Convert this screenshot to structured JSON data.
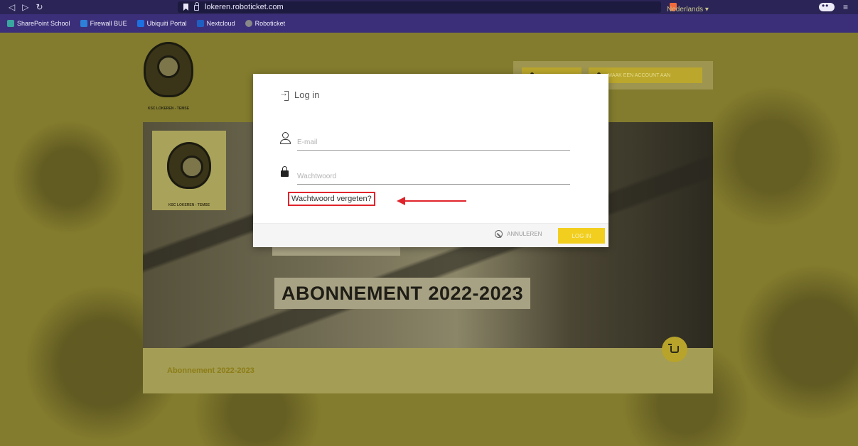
{
  "browser": {
    "url": "lokeren.roboticket.com",
    "bookmarks": [
      {
        "label": "SharePoint School",
        "color": "#3aa6a0"
      },
      {
        "label": "Firewall BUE",
        "color": "#2d7fd8"
      },
      {
        "label": "Ubiquiti Portal",
        "color": "#1e6fe0"
      },
      {
        "label": "Nextcloud",
        "color": "#1f5fc2"
      },
      {
        "label": "Roboticket",
        "color": "#888888"
      }
    ]
  },
  "page": {
    "language": "Nederlands ▾",
    "top_buttons": {
      "create_account": "MAAK EEN ACCOUNT AAN"
    },
    "crest_caption": "KSC LOKEREN - TEMSE",
    "hero_title": "ABONNEMENT 2022-2023",
    "info_title": "Abonnement 2022-2023"
  },
  "modal": {
    "title": "Log in",
    "email_placeholder": "E-mail",
    "password_placeholder": "Wachtwoord",
    "forgot_password": "Wachtwoord vergeten?",
    "cancel_label": "ANNULEREN",
    "login_label": "LOG IN",
    "accent_color": "#f2cf1f"
  }
}
